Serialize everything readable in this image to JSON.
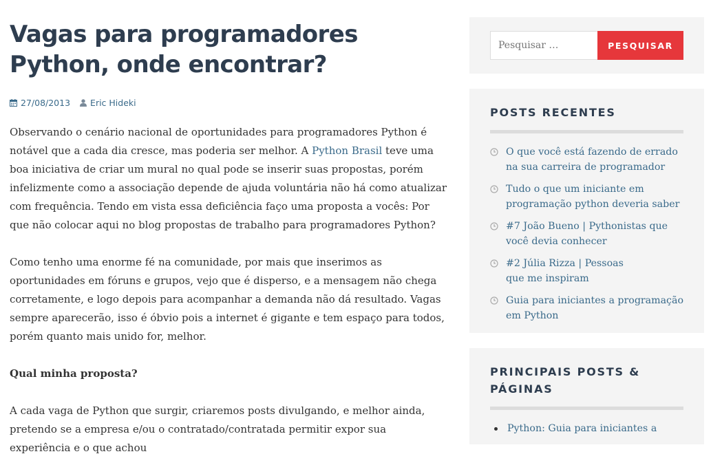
{
  "post": {
    "title": "Vagas para programadores Python, onde encontrar?",
    "date": "27/08/2013",
    "author": "Eric Hideki",
    "p1_before": "Observando o cenário nacional de oportunidades para programadores Python é notável que a cada dia cresce, mas poderia ser melhor. A ",
    "p1_link": "Python Brasil",
    "p1_after": " teve uma boa iniciativa de criar um mural no qual pode se inserir suas propostas, porém infelizmente como a associação depende de ajuda voluntária não há como atualizar com frequência. Tendo em vista essa deficiência faço uma proposta a vocês: Por que não colocar aqui no blog propostas de trabalho para programadores Python?",
    "p2": "Como tenho uma enorme fé na comunidade, por mais que inserimos as oportunidades em fóruns e grupos, vejo que é disperso, e a mensagem não chega corretamente, e logo depois para acompanhar a demanda não dá resultado. Vagas sempre aparecerão, isso é óbvio pois a internet é gigante e tem espaço para todos, porém quanto mais unido for, melhor.",
    "p3_heading": "Qual minha proposta?",
    "p4": "A cada vaga de Python que surgir, criaremos posts divulgando, e melhor ainda, pretendo se a empresa e/ou o contratado/contratada permitir expor sua experiência e o que achou"
  },
  "search": {
    "placeholder": "Pesquisar …",
    "button_label": "PESQUISAR"
  },
  "recent_posts": {
    "title": "POSTS RECENTES",
    "items": [
      "O que você está fazendo de errado na sua carreira de programador",
      "Tudo o que um iniciante em programação python deveria saber",
      "#7 João Bueno | Pythonistas que você devia conhecer",
      "#2 Júlia Rizza | Pessoas que me inspiram",
      "Guia para iniciantes a programação em Python"
    ]
  },
  "top_posts": {
    "title": "PRINCIPAIS POSTS & PÁGINAS",
    "items": [
      "Python: Guia para iniciantes a"
    ]
  },
  "colors": {
    "title": "#2e3d4f",
    "link": "#3a6a8a",
    "accent_button": "#e6373b",
    "widget_bg": "#f4f4f4"
  }
}
